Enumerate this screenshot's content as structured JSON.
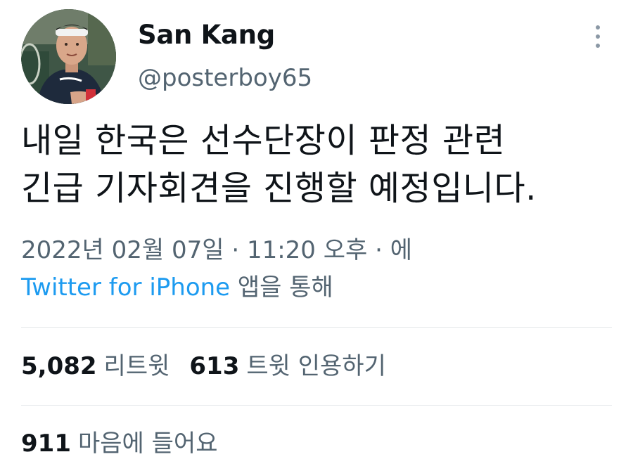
{
  "user": {
    "name": "San Kang",
    "handle": "@posterboy65"
  },
  "tweet": {
    "text_line1": "내일 한국은 선수단장이 판정 관련",
    "text_line2": "긴급 기자회견을 진행할 예정입니다."
  },
  "meta": {
    "date": "2022년 02월 07일",
    "separator1": " · ",
    "time": "11:20 오후",
    "separator2": " · ",
    "suffix": "에",
    "source": "Twitter for iPhone",
    "source_suffix": " 앱을 통해"
  },
  "stats": {
    "retweets_count": "5,082",
    "retweets_label": "리트윗",
    "quotes_count": "613",
    "quotes_label": "트윗 인용하기",
    "likes_count": "911",
    "likes_label": "마음에 들어요"
  },
  "colors": {
    "text": "#0f1419",
    "secondary": "#536471",
    "link": "#1d9bf0",
    "divider": "#e6e9eb"
  },
  "icons": {
    "more": "more-vertical-icon"
  }
}
